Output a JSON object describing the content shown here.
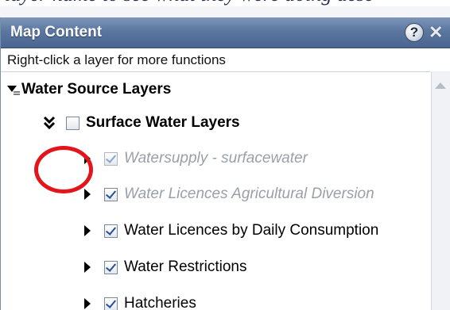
{
  "caption": "layer name to see what they were doing desc",
  "panel": {
    "title": "Map Content",
    "help_symbol": "?",
    "close_symbol": "✕",
    "hint": "Right-click a layer for more functions"
  },
  "tree": {
    "group": {
      "label": "Water Source Layers",
      "expanded": true
    },
    "subgroup": {
      "label": "Surface Water Layers",
      "expanded": true,
      "checked": false
    },
    "layers": [
      {
        "label": "Watersupply - surfacewater",
        "checked": true,
        "visible_at_scale": false
      },
      {
        "label": "Water Licences Agricultural Diversion",
        "checked": true,
        "visible_at_scale": false
      },
      {
        "label": "Water Licences by Daily Consumption",
        "checked": true,
        "visible_at_scale": true
      },
      {
        "label": "Water Restrictions",
        "checked": true,
        "visible_at_scale": true
      },
      {
        "label": "Hatcheries",
        "checked": true,
        "visible_at_scale": true
      }
    ]
  },
  "annotation": {
    "highlight_color": "#e3141b",
    "target": "Watersupply - surfacewater expander"
  }
}
